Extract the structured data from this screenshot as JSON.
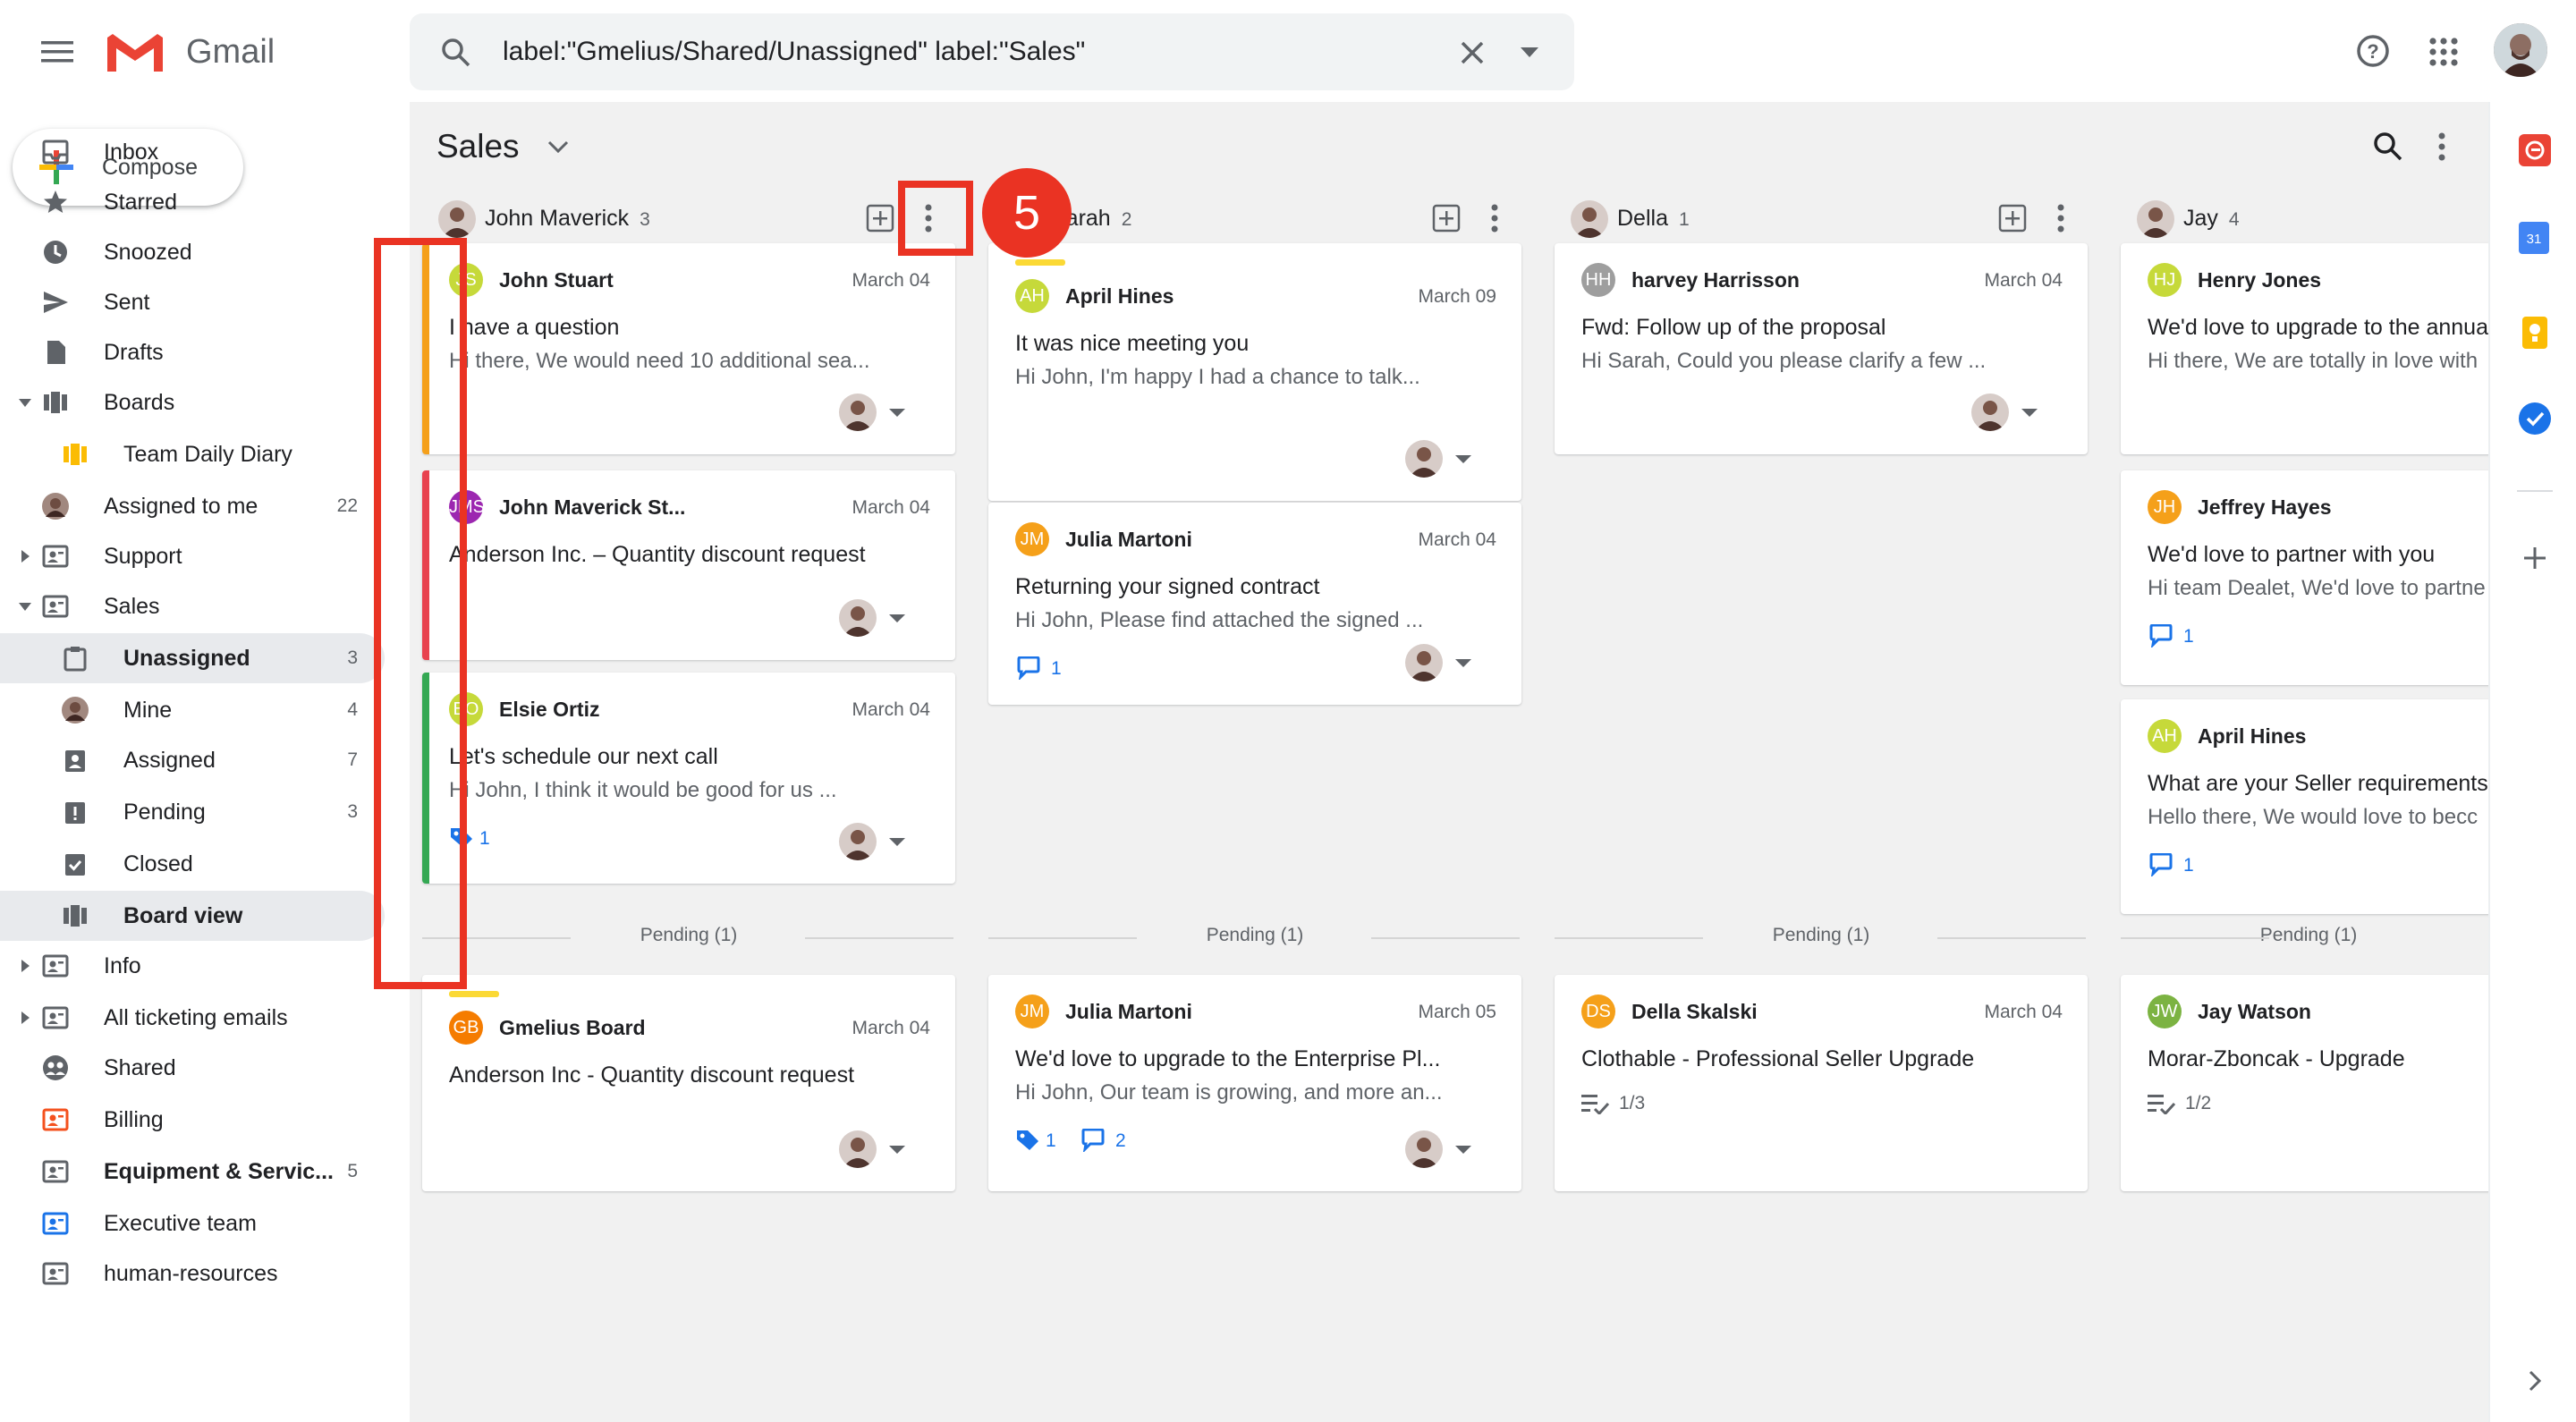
{
  "header": {
    "app_name": "Gmail",
    "search_query": "label:\"Gmelius/Shared/Unassigned\" label:\"Sales\"",
    "icons": [
      "menu-icon",
      "gmail-logo",
      "search-icon",
      "close-icon",
      "chevron-down-icon",
      "help-icon",
      "apps-grid-icon",
      "user-avatar"
    ]
  },
  "sidebar": {
    "compose_label": "Compose",
    "items": [
      {
        "label": "Inbox",
        "icon": "inbox-icon"
      },
      {
        "label": "Starred",
        "icon": "star-icon"
      },
      {
        "label": "Snoozed",
        "icon": "clock-icon"
      },
      {
        "label": "Sent",
        "icon": "send-icon"
      },
      {
        "label": "Drafts",
        "icon": "draft-icon"
      },
      {
        "label": "Boards",
        "icon": "board-icon"
      },
      {
        "label": "Team Daily Diary",
        "icon": "board-icon"
      },
      {
        "label": "Assigned to me",
        "icon": "avatar",
        "count": "22"
      },
      {
        "label": "Support",
        "icon": "shared-label-icon"
      },
      {
        "label": "Sales",
        "icon": "shared-label-icon"
      },
      {
        "label": "Unassigned",
        "icon": "unassigned-icon",
        "count": "3"
      },
      {
        "label": "Mine",
        "icon": "avatar",
        "count": "4"
      },
      {
        "label": "Assigned",
        "icon": "assigned-icon",
        "count": "7"
      },
      {
        "label": "Pending",
        "icon": "pending-icon",
        "count": "3"
      },
      {
        "label": "Closed",
        "icon": "closed-icon"
      },
      {
        "label": "Board view",
        "icon": "board-icon"
      },
      {
        "label": "Info",
        "icon": "shared-label-icon"
      },
      {
        "label": "All ticketing emails",
        "icon": "shared-label-icon"
      },
      {
        "label": "Shared",
        "icon": "shared-icon"
      },
      {
        "label": "Billing",
        "icon": "shared-label-icon"
      },
      {
        "label": "Equipment & Servic...",
        "icon": "shared-label-icon",
        "count": "5"
      },
      {
        "label": "Executive team",
        "icon": "shared-label-icon"
      },
      {
        "label": "human-resources",
        "icon": "shared-label-icon"
      }
    ]
  },
  "board": {
    "title": "Sales",
    "step_badge": "5",
    "columns": [
      {
        "name": "John Maverick",
        "count": "3",
        "cards": [
          {
            "initials": "JS",
            "sender": "John Stuart",
            "date": "March 04",
            "subject": "I have a question",
            "snippet": "Hi there, We would need 10 additional sea..."
          },
          {
            "initials": "JMS",
            "sender": "John Maverick St...",
            "date": "March 04",
            "subject": "Anderson Inc. – Quantity discount request",
            "snippet": ""
          },
          {
            "initials": "EO",
            "sender": "Elsie Ortiz",
            "date": "March 04",
            "subject": "Let's schedule our next call",
            "snippet": "Hi John, I think it would be good for us ...",
            "tags": "1"
          }
        ],
        "pending_label": "Pending (1)",
        "pending_cards": [
          {
            "initials": "GB",
            "sender": "Gmelius Board",
            "date": "March 04",
            "subject": "Anderson Inc - Quantity discount request"
          }
        ]
      },
      {
        "name": "Sarah",
        "count": "2",
        "cards": [
          {
            "initials": "AH",
            "sender": "April Hines",
            "date": "March 09",
            "subject": "It was nice meeting you",
            "snippet": "Hi John, I'm happy I had a chance to talk..."
          },
          {
            "initials": "JM",
            "sender": "Julia Martoni",
            "date": "March 04",
            "subject": "Returning your signed contract",
            "snippet": "Hi John, Please find attached the signed ...",
            "comments": "1"
          }
        ],
        "pending_label": "Pending (1)",
        "pending_cards": [
          {
            "initials": "JM",
            "sender": "Julia Martoni",
            "date": "March 05",
            "subject": "We'd love to upgrade to the Enterprise Pl...",
            "snippet": "Hi John, Our team is growing, and more an...",
            "tags": "1",
            "comments": "2"
          }
        ]
      },
      {
        "name": "Della",
        "count": "1",
        "cards": [
          {
            "initials": "HH",
            "sender": "harvey Harrisson",
            "date": "March 04",
            "subject": "Fwd: Follow up of the proposal",
            "snippet": "Hi Sarah, Could you please clarify a few ..."
          }
        ],
        "pending_label": "Pending (1)",
        "pending_cards": [
          {
            "initials": "DS",
            "sender": "Della Skalski",
            "date": "March 04",
            "subject": "Clothable - Professional Seller Upgrade",
            "checklist": "1/3"
          }
        ]
      },
      {
        "name": "Jay",
        "count": "4",
        "cards": [
          {
            "initials": "HJ",
            "sender": "Henry Jones",
            "date": "",
            "subject": "We'd love to upgrade to the annua",
            "snippet": "Hi there, We are totally in love with"
          },
          {
            "initials": "JH",
            "sender": "Jeffrey Hayes",
            "date": "",
            "subject": "We'd love to partner with you",
            "snippet": "Hi team Dealet, We'd love to partne",
            "comments": "1"
          },
          {
            "initials": "AH",
            "sender": "April Hines",
            "date": "",
            "subject": "What are your Seller requirements",
            "snippet": "Hello there, We would love to becc",
            "comments": "1"
          }
        ],
        "pending_label": "Pending (1)",
        "pending_cards": [
          {
            "initials": "JW",
            "sender": "Jay Watson",
            "date": "",
            "subject": "Morar-Zboncak - Upgrade",
            "checklist": "1/2"
          }
        ]
      }
    ]
  },
  "right_rail": {
    "calendar_day": "31"
  },
  "colors": {
    "accent_red": "#ea4335",
    "blue": "#1a73e8",
    "bar_orange": "#f5a01a",
    "bar_red": "#e8424f",
    "bar_green": "#34a853",
    "bar_yellow": "#fbd935"
  }
}
